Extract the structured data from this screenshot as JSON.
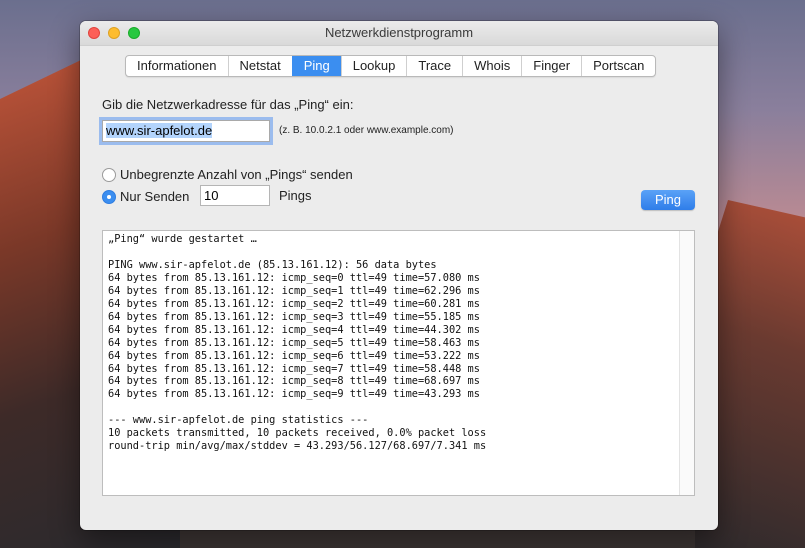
{
  "window": {
    "title": "Netzwerkdienstprogramm"
  },
  "tabs": [
    {
      "label": "Informationen"
    },
    {
      "label": "Netstat"
    },
    {
      "label": "Ping"
    },
    {
      "label": "Lookup"
    },
    {
      "label": "Trace"
    },
    {
      "label": "Whois"
    },
    {
      "label": "Finger"
    },
    {
      "label": "Portscan"
    }
  ],
  "form": {
    "prompt": "Gib die Netzwerkadresse für das „Ping“ ein:",
    "address_value": "www.sir-apfelot.de",
    "hint": "(z. B. 10.0.2.1 oder www.example.com)",
    "radio_unlimited": "Unbegrenzte Anzahl von „Pings“ senden",
    "radio_only_send": "Nur Senden",
    "count_value": "10",
    "pings_label": "Pings",
    "ping_button": "Ping"
  },
  "output": {
    "lines": [
      "„Ping“ wurde gestartet …",
      "",
      "PING www.sir-apfelot.de (85.13.161.12): 56 data bytes",
      "64 bytes from 85.13.161.12: icmp_seq=0 ttl=49 time=57.080 ms",
      "64 bytes from 85.13.161.12: icmp_seq=1 ttl=49 time=62.296 ms",
      "64 bytes from 85.13.161.12: icmp_seq=2 ttl=49 time=60.281 ms",
      "64 bytes from 85.13.161.12: icmp_seq=3 ttl=49 time=55.185 ms",
      "64 bytes from 85.13.161.12: icmp_seq=4 ttl=49 time=44.302 ms",
      "64 bytes from 85.13.161.12: icmp_seq=5 ttl=49 time=58.463 ms",
      "64 bytes from 85.13.161.12: icmp_seq=6 ttl=49 time=53.222 ms",
      "64 bytes from 85.13.161.12: icmp_seq=7 ttl=49 time=58.448 ms",
      "64 bytes from 85.13.161.12: icmp_seq=8 ttl=49 time=68.697 ms",
      "64 bytes from 85.13.161.12: icmp_seq=9 ttl=49 time=43.293 ms",
      "",
      "--- www.sir-apfelot.de ping statistics ---",
      "10 packets transmitted, 10 packets received, 0.0% packet loss",
      "round-trip min/avg/max/stddev = 43.293/56.127/68.697/7.341 ms"
    ]
  },
  "colors": {
    "accent": "#3b8ef0"
  }
}
